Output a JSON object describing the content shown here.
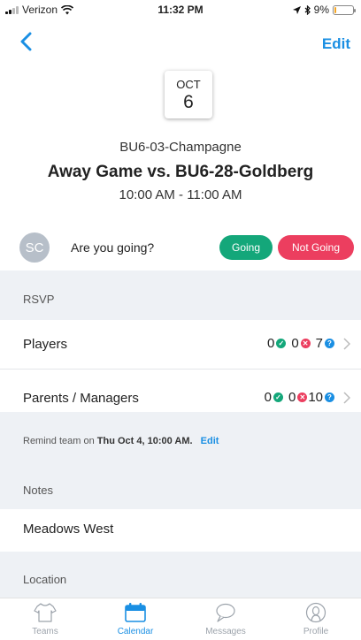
{
  "status_bar": {
    "carrier": "Verizon",
    "time": "11:32 PM",
    "battery_percent": "9%",
    "battery_level": 0.09
  },
  "nav": {
    "edit_label": "Edit"
  },
  "event": {
    "month": "OCT",
    "day": "6",
    "team": "BU6-03-Champagne",
    "title": "Away Game vs. BU6-28-Goldberg",
    "time_range": "10:00 AM - 11:00 AM"
  },
  "attendance": {
    "avatar_initials": "SC",
    "question": "Are you going?",
    "going_label": "Going",
    "not_going_label": "Not Going"
  },
  "rsvp": {
    "section_title": "RSVP",
    "rows": [
      {
        "label": "Players",
        "yes": "0",
        "no": "0",
        "unknown": "7"
      },
      {
        "label": "Parents / Managers",
        "yes": "0",
        "no": "0",
        "unknown": "10"
      }
    ],
    "remind_prefix": "Remind team on",
    "remind_when": "Thu Oct 4, 10:00 AM.",
    "remind_edit": "Edit"
  },
  "notes": {
    "section_title": "Notes",
    "text": "Meadows West"
  },
  "location": {
    "section_title": "Location"
  },
  "tabs": [
    {
      "label": "Teams",
      "icon": "jersey-icon",
      "active": false
    },
    {
      "label": "Calendar",
      "icon": "calendar-icon",
      "active": true
    },
    {
      "label": "Messages",
      "icon": "chat-bubble-icon",
      "active": false
    },
    {
      "label": "Profile",
      "icon": "person-icon",
      "active": false
    }
  ],
  "colors": {
    "accent": "#1a8fe3",
    "going": "#14a77a",
    "not_going": "#ec3e5f",
    "section_bg": "#eef1f5"
  }
}
